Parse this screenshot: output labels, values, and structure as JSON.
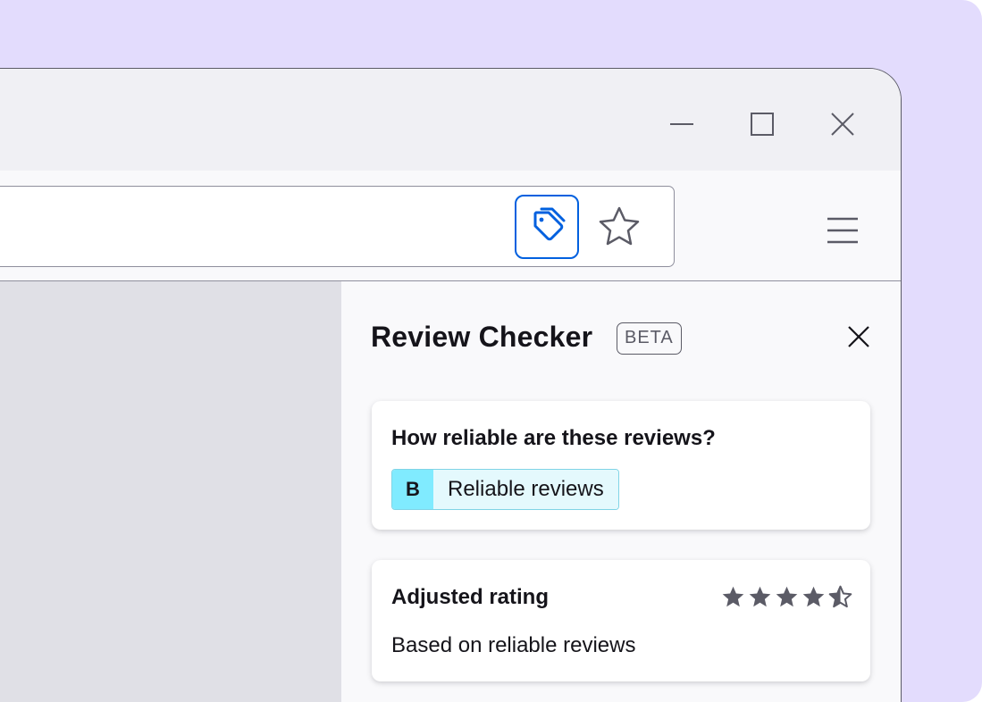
{
  "colors": {
    "backdrop": "#e3dcfd",
    "accent_blue": "#0060df",
    "grade_b": "#80ebff",
    "grade_b_bg": "#e4f9fd",
    "star": "#5b5b66"
  },
  "window_controls": {
    "minimize_icon": "minimize-icon",
    "maximize_icon": "maximize-icon",
    "close_icon": "close-icon"
  },
  "toolbar": {
    "shopping_icon": "price-tag-icon",
    "bookmark_icon": "star-outline-icon",
    "menu_icon": "hamburger-menu-icon"
  },
  "sidebar": {
    "title": "Review Checker",
    "badge": "BETA",
    "close_icon": "close-icon",
    "reliability_card": {
      "heading": "How reliable are these reviews?",
      "grade": "B",
      "grade_label": "Reliable reviews"
    },
    "rating_card": {
      "heading": "Adjusted rating",
      "rating": 4.5,
      "max_rating": 5,
      "subtext": "Based on reliable reviews"
    }
  }
}
